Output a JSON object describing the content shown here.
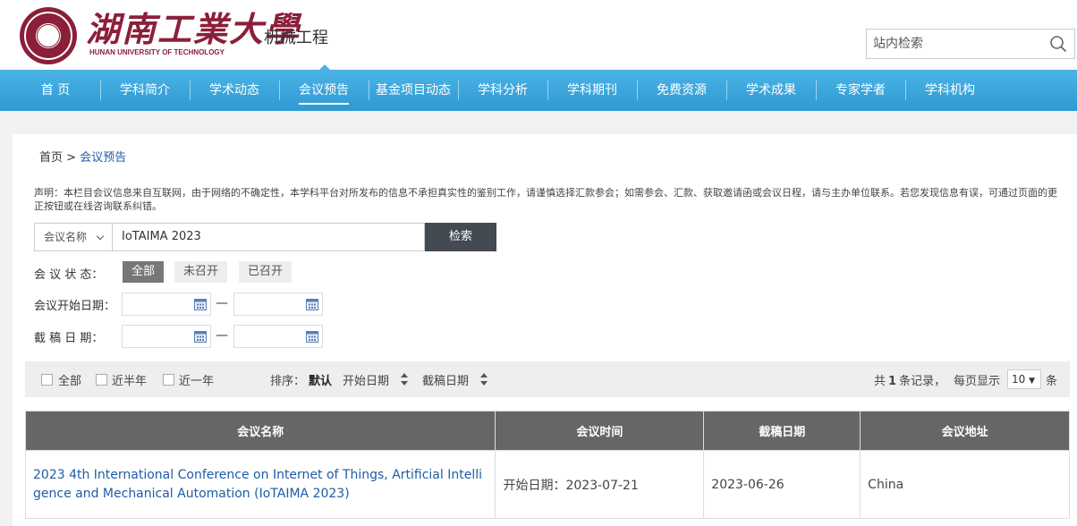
{
  "header": {
    "logo_cn": "湖南工業大學",
    "logo_en": "HUNAN UNIVERSITY OF TECHNOLOGY",
    "site_name": "机械工程",
    "search_placeholder": "站内检索"
  },
  "nav": {
    "items": [
      "首 页",
      "学科简介",
      "学术动态",
      "会议预告",
      "基金项目动态",
      "学科分析",
      "学科期刊",
      "免费资源",
      "学术成果",
      "专家学者",
      "学科机构"
    ],
    "active_index": 3
  },
  "breadcrumb": {
    "home": "首页",
    "sep": ">",
    "current": "会议预告"
  },
  "notice": "声明：本栏目会议信息来自互联网，由于网络的不确定性，本学科平台对所发布的信息不承担真实性的鉴别工作，请谨慎选择汇款参会；如需参会、汇款、获取邀请函或会议日程，请与主办单位联系。若您发现信息有误，可通过页面的更正按钮或在线咨询联系纠错。",
  "search": {
    "field_select": "会议名称",
    "keyword": "IoTAIMA 2023",
    "button": "检索"
  },
  "filters": {
    "status_label": "会 议 状 态：",
    "status_options": [
      "全部",
      "未召开",
      "已召开"
    ],
    "status_selected": "全部",
    "start_label": "会议开始日期：",
    "deadline_label": "截 稿 日 期：",
    "range_sep": "—"
  },
  "toolbar": {
    "checks": [
      "全部",
      "近半年",
      "近一年"
    ],
    "sort_label": "排序：",
    "sort_default": "默认",
    "sort_start": "开始日期",
    "sort_deadline": "截稿日期",
    "total_prefix": "共",
    "total_count": "1",
    "total_suffix": "条记录，",
    "page_size_prefix": "每页显示",
    "page_size": "10",
    "page_size_suffix": "条"
  },
  "table": {
    "headers": [
      "会议名称",
      "会议时间",
      "截稿日期",
      "会议地址"
    ],
    "rows": [
      {
        "name": "2023 4th International Conference on Internet of Things, Artificial Intelligence and Mechanical Automation (IoTAIMA 2023)",
        "time": "开始日期：2023-07-21",
        "deadline": "2023-06-26",
        "location": "China"
      }
    ]
  },
  "colors": {
    "nav": "#3aa6dc",
    "brand": "#8b1f3a",
    "link": "#1e5ca8",
    "table_header": "#666666"
  }
}
